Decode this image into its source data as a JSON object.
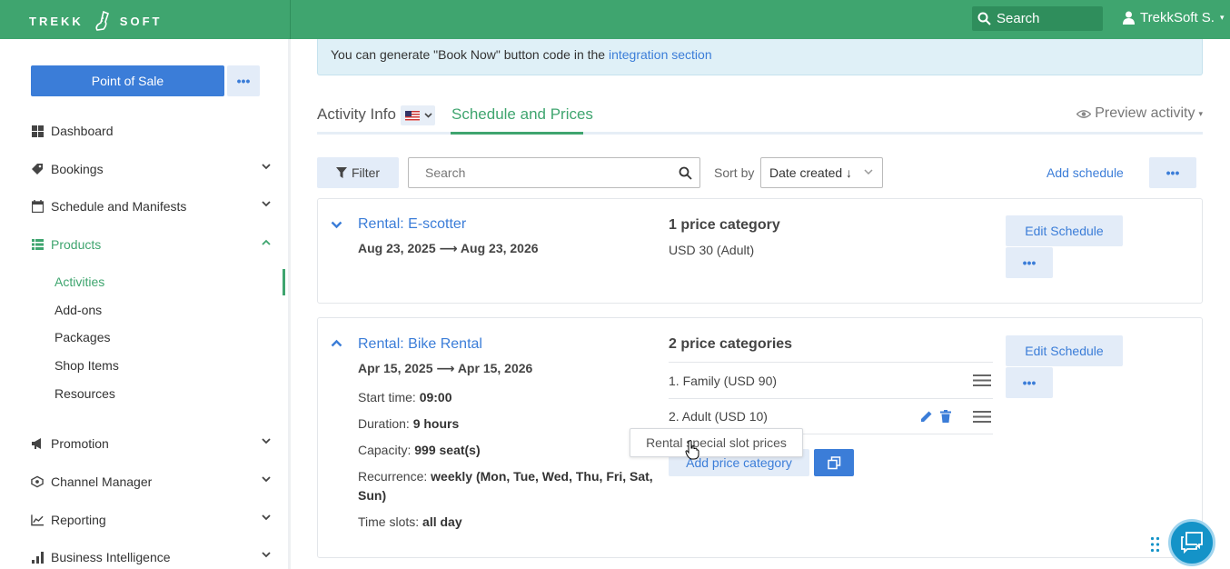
{
  "header": {
    "logo_left": "TREKK",
    "logo_right": "SOFT",
    "search_label": "Search",
    "user_name": "TrekkSoft S."
  },
  "sidebar": {
    "pos_label": "Point of Sale",
    "more_label": "•••",
    "items": [
      {
        "label": "Dashboard",
        "icon": "dashboard-icon"
      },
      {
        "label": "Bookings",
        "icon": "tag-icon"
      },
      {
        "label": "Schedule and Manifests",
        "icon": "calendar-icon"
      },
      {
        "label": "Products",
        "icon": "list-icon"
      },
      {
        "label": "Promotion",
        "icon": "megaphone-icon"
      },
      {
        "label": "Channel Manager",
        "icon": "network-icon"
      },
      {
        "label": "Reporting",
        "icon": "line-chart-icon"
      },
      {
        "label": "Business Intelligence",
        "icon": "bar-chart-icon"
      }
    ],
    "products_sub": [
      "Activities",
      "Add-ons",
      "Packages",
      "Shop Items",
      "Resources"
    ]
  },
  "banner": {
    "text": "You can generate \"Book Now\" button code in the ",
    "link": "integration section"
  },
  "tabs": {
    "activity_info": "Activity Info",
    "schedule_prices": "Schedule and Prices",
    "preview": "Preview activity"
  },
  "toolbar": {
    "filter": "Filter",
    "search_placeholder": "Search",
    "sort_by": "Sort by",
    "sort_value": "Date created ↓",
    "add_schedule": "Add schedule",
    "more": "•••"
  },
  "schedules": [
    {
      "title": "Rental: E-scotter",
      "dates": "Aug 23, 2025 ⟶ Aug 23, 2026",
      "price_count": "1 price category",
      "price_summary": "USD 30 (Adult)",
      "edit": "Edit Schedule",
      "more": "•••"
    },
    {
      "title": "Rental: Bike Rental",
      "dates": "Apr 15, 2025 ⟶ Apr 15, 2026",
      "start_label": "Start time: ",
      "start_value": "09:00",
      "duration_label": "Duration: ",
      "duration_value": "9 hours",
      "capacity_label": "Capacity: ",
      "capacity_value": "999 seat(s)",
      "recurrence_label": "Recurrence: ",
      "recurrence_value_1": "weekly (Mon, Tue, Wed, Thu, Fri, Sat,",
      "recurrence_value_2": "Sun)",
      "timeslots_label": "Time slots: ",
      "timeslots_value": "all day",
      "price_count": "2 price categories",
      "prices": [
        "1. Family (USD 90)",
        "2. Adult (USD 10)"
      ],
      "add_price": "Add price category",
      "tooltip": "Rental special slot prices",
      "edit": "Edit Schedule",
      "more": "•••"
    }
  ],
  "colors": {
    "brand_green": "#3fa56f",
    "link_blue": "#3b7dd8",
    "light_blue_button": "#e3ecf8"
  }
}
